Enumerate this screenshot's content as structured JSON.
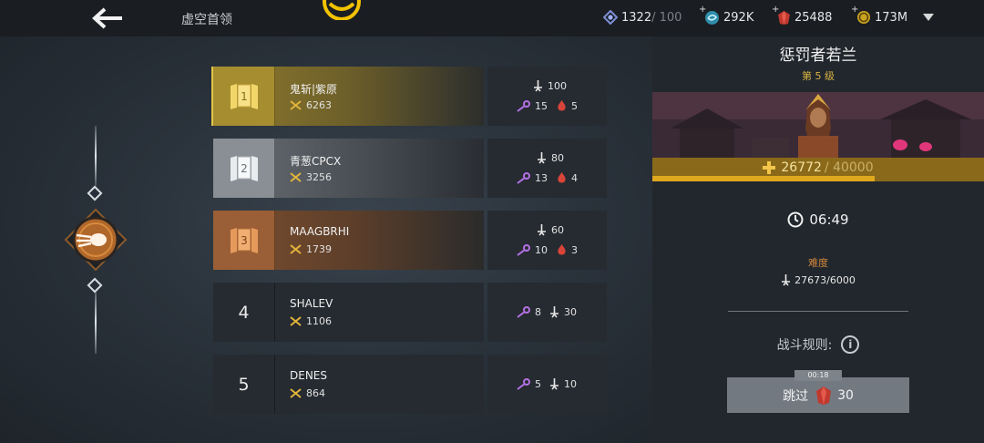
{
  "header": {
    "title": "虚空首领",
    "back_icon": "arrow-left-icon",
    "resources": [
      {
        "icon": "energy-gem-icon",
        "value": "1322",
        "cap": " / 100",
        "has_plus": false
      },
      {
        "icon": "orb-icon",
        "value": "292K",
        "cap": "",
        "has_plus": true
      },
      {
        "icon": "ruby-icon",
        "value": "25488",
        "cap": "",
        "has_plus": true
      },
      {
        "icon": "coin-icon",
        "value": "173M",
        "cap": "",
        "has_plus": true
      }
    ]
  },
  "leaderboard": [
    {
      "rank": "1",
      "name": "鬼斩|紫原",
      "power": "6263",
      "tier": "gold",
      "damage": "100",
      "keys": "15",
      "ruby": "5"
    },
    {
      "rank": "2",
      "name": "青葱CPCX",
      "power": "3256",
      "tier": "silver",
      "damage": "80",
      "keys": "13",
      "ruby": "4"
    },
    {
      "rank": "3",
      "name": "MAAGBRHI",
      "power": "1739",
      "tier": "bronze",
      "damage": "60",
      "keys": "10",
      "ruby": "3"
    },
    {
      "rank": "4",
      "name": "SHALEV",
      "power": "1106",
      "tier": "plain",
      "keys": "8",
      "damage": "30"
    },
    {
      "rank": "5",
      "name": "DENES",
      "power": "864",
      "tier": "plain",
      "keys": "5",
      "damage": "10"
    }
  ],
  "boss": {
    "name": "惩罚者若兰",
    "level": "第 5 级",
    "hp_current": "26772",
    "hp_max": "/ 40000",
    "hp_fraction": 0.669,
    "timer": "06:49",
    "difficulty_label": "难度",
    "difficulty_value": "27673/6000",
    "rules_label": "战斗规则:",
    "skip_timer": "00:18",
    "skip_label": "跳过",
    "skip_cost": "30"
  },
  "colors": {
    "gold": "#a58d30",
    "silver": "#8a8f95",
    "bronze": "#9a5f36",
    "accent": "#e0a81e"
  }
}
